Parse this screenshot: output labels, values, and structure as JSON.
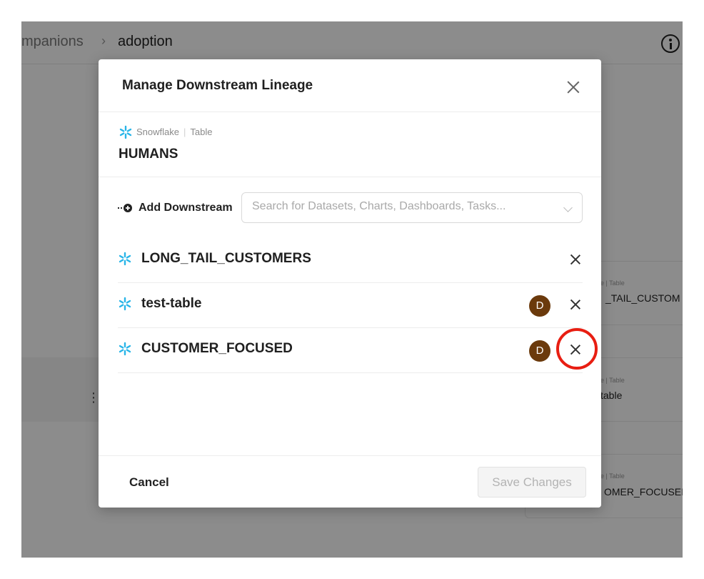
{
  "background": {
    "breadcrumb_prev": "mpanions",
    "breadcrumb_sep": "›",
    "breadcrumb_current": "adoption",
    "cards": [
      {
        "meta": "e | Table",
        "name": "_TAIL_CUSTOM"
      },
      {
        "meta": "e | Table",
        "name": "table"
      },
      {
        "meta": "e | Table",
        "name": "OMER_FOCUSEI"
      }
    ],
    "kebab": "⋮"
  },
  "modal": {
    "title": "Manage Downstream Lineage",
    "entity": {
      "platform": "Snowflake",
      "type": "Table",
      "name": "HUMANS"
    },
    "add_downstream_label": "Add Downstream",
    "search_placeholder": "Search for Datasets, Charts, Dashboards, Tasks...",
    "rows": [
      {
        "name": "LONG_TAIL_CUSTOMERS",
        "has_avatar": false,
        "avatar": ""
      },
      {
        "name": "test-table",
        "has_avatar": true,
        "avatar": "D"
      },
      {
        "name": "CUSTOMER_FOCUSED",
        "has_avatar": true,
        "avatar": "D"
      }
    ],
    "cancel_label": "Cancel",
    "save_label": "Save Changes"
  },
  "colors": {
    "snowflake": "#29B5E8",
    "avatar": "#6B3A0C",
    "highlight": "#E81E12"
  }
}
